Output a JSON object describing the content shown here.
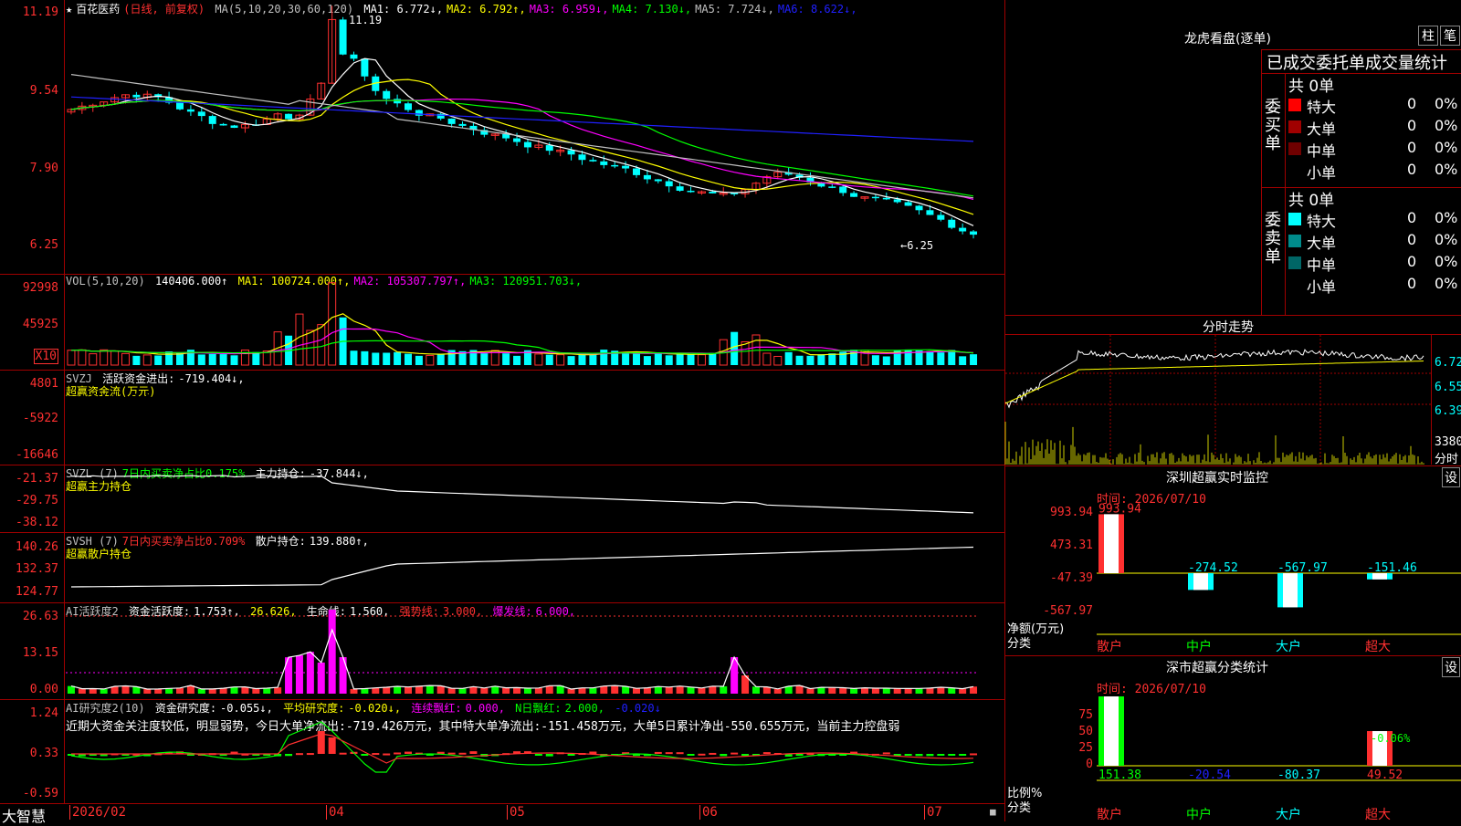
{
  "stock": {
    "star": "★",
    "name": "百花医药",
    "mode": "(日线, 前复权)"
  },
  "main": {
    "ma_label": "MA(5,10,20,30,60,120)",
    "ma": [
      {
        "label": "MA1:",
        "value": "6.772↓",
        "color": "#ffffff"
      },
      {
        "label": "MA2:",
        "value": "6.792↑",
        "color": "#ffff00"
      },
      {
        "label": "MA3:",
        "value": "6.959↓",
        "color": "#ff00ff"
      },
      {
        "label": "MA4:",
        "value": "7.130↓",
        "color": "#00ff00"
      },
      {
        "label": "MA5:",
        "value": "7.724↓",
        "color": "#c0c0c0"
      },
      {
        "label": "MA6:",
        "value": "8.622↓",
        "color": "#2020ff"
      }
    ],
    "y_ticks": [
      "11.19",
      "9.54",
      "7.90",
      "6.25"
    ],
    "high_note": "11.19",
    "low_note": "←6.25"
  },
  "vol": {
    "label": "VOL(5,10,20)",
    "value": "140406.000↑",
    "ma": [
      {
        "label": "MA1:",
        "value": "100724.000↑",
        "color": "#ffff00"
      },
      {
        "label": "MA2:",
        "value": "105307.797↑",
        "color": "#ff00ff"
      },
      {
        "label": "MA3:",
        "value": "120951.703↓",
        "color": "#00ff00"
      }
    ],
    "y_ticks": [
      "92998",
      "45925"
    ],
    "unit": "X10"
  },
  "svzj": {
    "label": "SVZJ",
    "item": "活跃资金进出:",
    "value": "-719.404↓,",
    "sub": "超赢资金流(万元)",
    "y_ticks": [
      "4801",
      "-5922",
      "-16646"
    ]
  },
  "svzl": {
    "label": "SVZL (7)",
    "ratio": "7日内买卖净占比0.175%",
    "item": "主力持仓:",
    "value": "-37.844↓,",
    "sub": "超赢主力持仓",
    "y_ticks": [
      "-21.37",
      "-29.75",
      "-38.12"
    ]
  },
  "svsh": {
    "label": "SVSH (7)",
    "ratio": "7日内买卖净占比0.709%",
    "item": "散户持仓:",
    "value": "139.880↑,",
    "sub": "超赢散户持仓",
    "y_ticks": [
      "140.26",
      "132.37",
      "124.77"
    ]
  },
  "ai1": {
    "label": "AI活跃度2",
    "item": "资金活跃度:",
    "value": "1.753↑,",
    "v2": "26.626,",
    "item3": "生命线:",
    "v3": "1.560,",
    "item4": "强势线:",
    "v4": "3.000,",
    "item5": "爆发线:",
    "v5": "6.000,",
    "y_ticks": [
      "26.63",
      "13.15",
      "0.00"
    ]
  },
  "ai2": {
    "label": "AI研究度2(10)",
    "item": "资金研究度:",
    "value": "-0.055↓,",
    "item2": "平均研究度:",
    "v2": "-0.020↓,",
    "item3": "连续飘红:",
    "v3": "0.000,",
    "item4": "N日飘红:",
    "v4": "2.000,",
    "v5": "-0.020↓",
    "comment": "近期大资金关注度较低，明显弱势，今日大单净流出:-719.426万元，其中特大单净流出:-151.458万元，大单5日累计净出-550.655万元，当前主力控盘弱",
    "y_ticks": [
      "1.24",
      "0.33",
      "-0.59"
    ]
  },
  "xaxis": {
    "brand": "大智慧",
    "labels": [
      "2026/02",
      "04",
      "05",
      "06",
      "07"
    ]
  },
  "right": {
    "lhb_title": "龙虎看盘(逐单)",
    "btn_bar": "柱",
    "btn_pen": "笔",
    "stat_title": "已成交委托单成交量统计",
    "buy": {
      "side": "委买单",
      "total": "共 0单",
      "rows": [
        {
          "name": "特大",
          "n": "0",
          "p": "0%",
          "color": "#ff0000"
        },
        {
          "name": "大单",
          "n": "0",
          "p": "0%",
          "color": "#a00000"
        },
        {
          "name": "中单",
          "n": "0",
          "p": "0%",
          "color": "#700000"
        },
        {
          "name": "小单",
          "n": "0",
          "p": "0%",
          "color": ""
        }
      ]
    },
    "sell": {
      "side": "委卖单",
      "total": "共 0单",
      "rows": [
        {
          "name": "特大",
          "n": "0",
          "p": "0%",
          "color": "#00ffff"
        },
        {
          "name": "大单",
          "n": "0",
          "p": "0%",
          "color": "#008c8c"
        },
        {
          "name": "中单",
          "n": "0",
          "p": "0%",
          "color": "#006666"
        },
        {
          "name": "小单",
          "n": "0",
          "p": "0%",
          "color": ""
        }
      ]
    },
    "intraday": {
      "title": "分时走势",
      "y": [
        "6.72",
        "6.55",
        "6.39"
      ],
      "vol": "3380",
      "vol_unit": "分时"
    },
    "monitor": {
      "title": "深圳超赢实时监控",
      "set": "设",
      "time": "时间: 2026/07/10",
      "y": [
        "993.94",
        "473.31",
        "-47.39",
        "-567.97"
      ],
      "axis_label": "净额(万元)",
      "axis_label2": "分类",
      "cats": [
        "散户",
        "中户",
        "大户",
        "超大"
      ],
      "vals": [
        "993.94",
        "-274.52",
        "-567.97",
        "-151.46"
      ]
    },
    "classify": {
      "title": "深市超赢分类统计",
      "set": "设",
      "time": "时间: 2026/07/10",
      "y": [
        "75",
        "50",
        "25",
        "0"
      ],
      "axis_label": "比例%",
      "axis_label2": "分类",
      "cats": [
        "散户",
        "中户",
        "大户",
        "超大"
      ],
      "vals": [
        "151.38",
        "-20.54",
        "-80.37",
        "49.52"
      ],
      "top_note": "-0.06%"
    }
  }
}
